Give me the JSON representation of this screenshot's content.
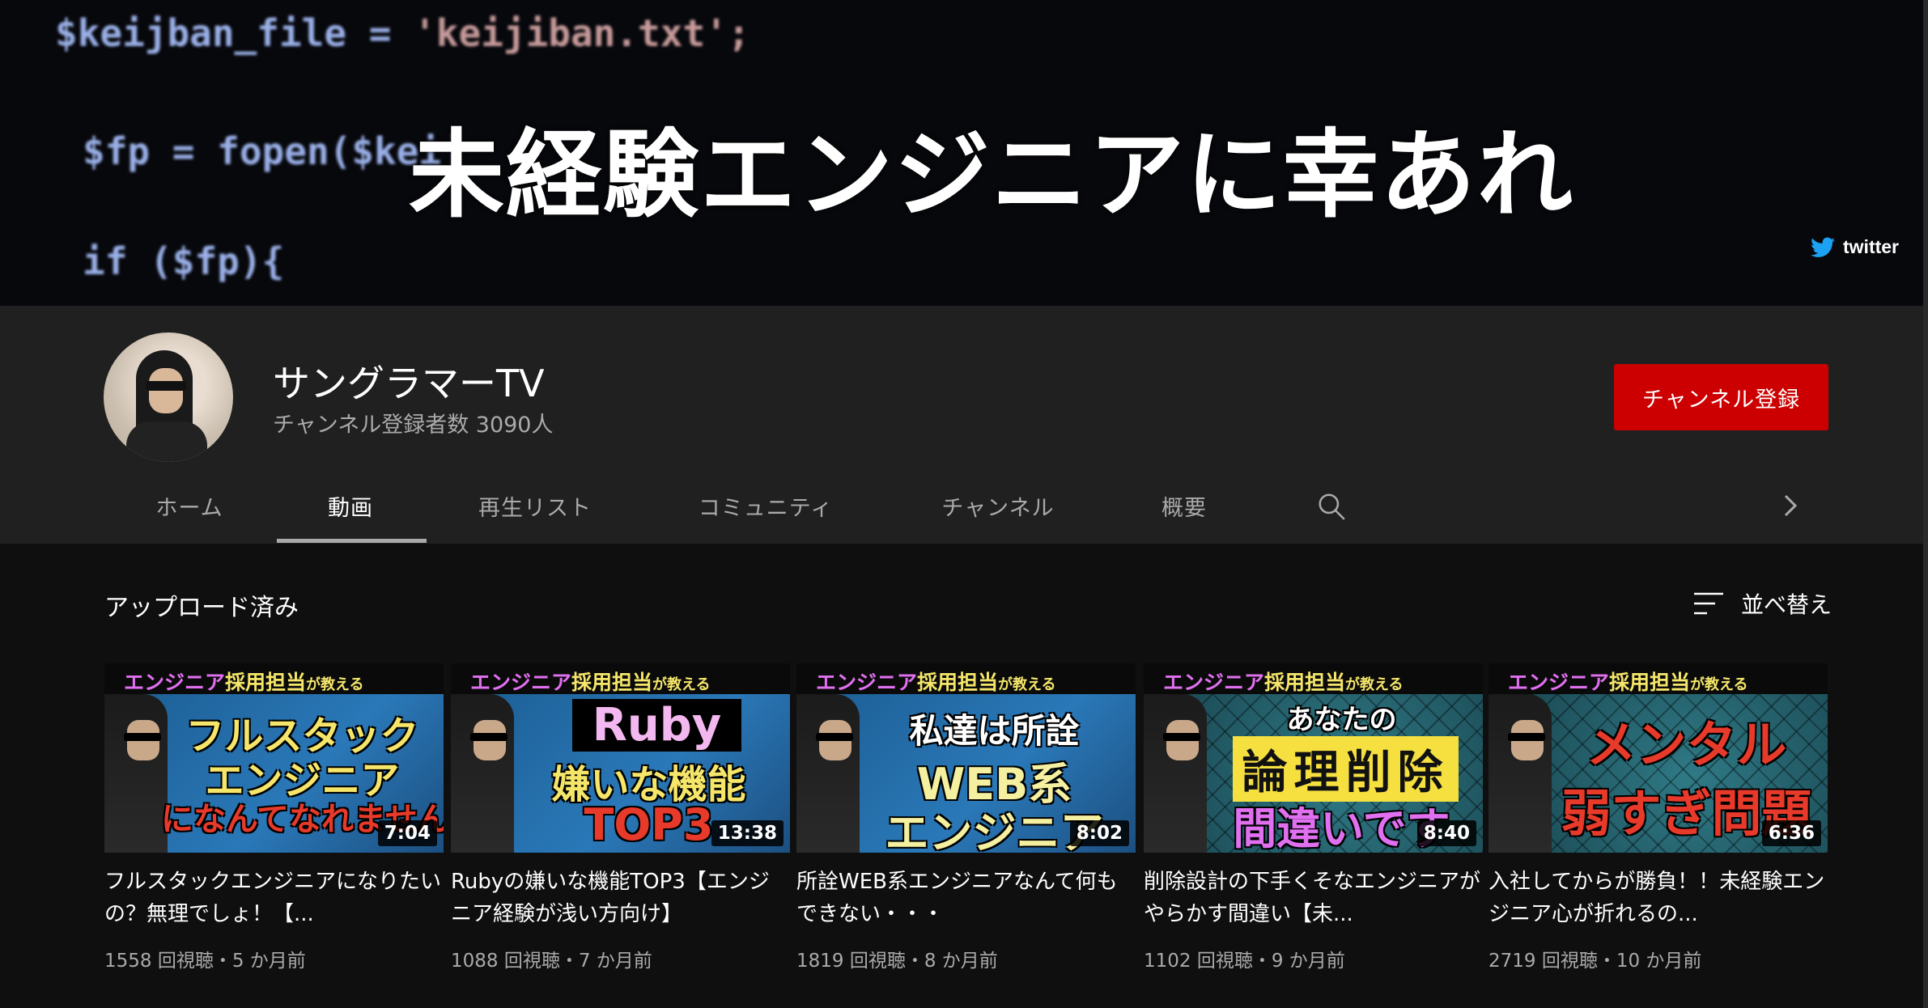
{
  "banner": {
    "code_lines": [
      "$keijban_file = ",
      "'keijiban.txt';",
      "$fp = fopen($keij",
      "if ($fp){"
    ],
    "title": "未経験エンジニアに幸あれ",
    "twitter_label": "twitter"
  },
  "channel": {
    "name": "サングラマーTV",
    "subscribers": "チャンネル登録者数 3090人",
    "subscribe_label": "チャンネル登録"
  },
  "tabs": [
    {
      "label": "ホーム"
    },
    {
      "label": "動画",
      "active": true
    },
    {
      "label": "再生リスト"
    },
    {
      "label": "コミュニティ"
    },
    {
      "label": "チャンネル"
    },
    {
      "label": "概要"
    }
  ],
  "section": {
    "title": "アップロード済み",
    "sort_label": "並べ替え"
  },
  "thumb_header": {
    "a": "エンジニア",
    "b": "採用担当",
    "c": "が教える"
  },
  "videos": [
    {
      "title": "フルスタックエンジニアになりたいの？無理でしょ！【...",
      "meta": "1558 回視聴・5 か月前",
      "duration": "7:04",
      "thumb_lines": [
        "フルスタック",
        "エンジニア",
        "になんてなれません！"
      ]
    },
    {
      "title": "Rubyの嫌いな機能TOP3【エンジニア経験が浅い方向け】",
      "meta": "1088 回視聴・7 か月前",
      "duration": "13:38",
      "thumb_lines": [
        "Ruby",
        "嫌いな機能",
        "TOP3"
      ]
    },
    {
      "title": "所詮WEB系エンジニアなんて何もできない・・・",
      "meta": "1819 回視聴・8 か月前",
      "duration": "8:02",
      "thumb_lines": [
        "私達は所詮",
        "WEB系",
        "エンジニア"
      ]
    },
    {
      "title": "削除設計の下手くそなエンジニアがやらかす間違い【未...",
      "meta": "1102 回視聴・9 か月前",
      "duration": "8:40",
      "thumb_lines": [
        "あなたの",
        "論理削除",
        "間違いです"
      ]
    },
    {
      "title": "入社してからが勝負！！未経験エンジニア心が折れるの...",
      "meta": "2719 回視聴・10 か月前",
      "duration": "6:36",
      "thumb_lines": [
        "メンタル",
        "弱すぎ問題"
      ]
    }
  ],
  "colors": {
    "subscribe": "#cc0000",
    "background": "#0f0f0f",
    "header": "#202020"
  }
}
